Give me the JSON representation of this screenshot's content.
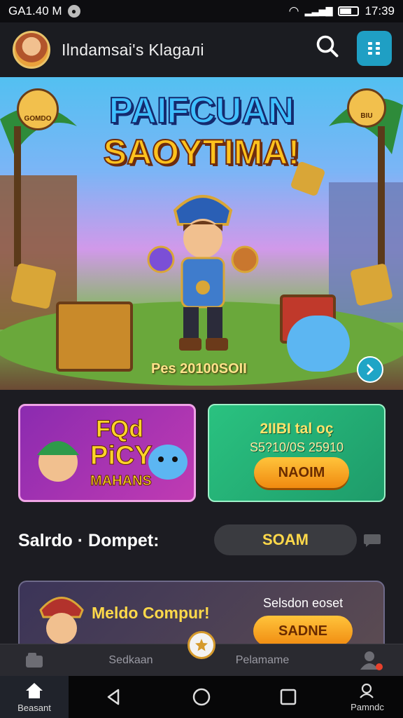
{
  "statusbar": {
    "carrier": "GA1.40 M",
    "time": "17:39"
  },
  "header": {
    "title": "Ilndamsai's Klagaлi",
    "search_icon": "search-icon",
    "menu_icon": "grid-menu-icon"
  },
  "banner": {
    "title_line1": "PAIFCUAN",
    "title_line2": "SAOYTIMA!",
    "badge_left": "GOMDO",
    "badge_right": "BIU",
    "caption": "Pes 20100SOII"
  },
  "promo_left": {
    "line1": "FQd",
    "line2": "PiCY",
    "line3": "MAHANS"
  },
  "promo_right": {
    "line1": "2IIBI tal oç",
    "line2": "S5?10/0S 25910",
    "button": "NAOIM"
  },
  "saldo": {
    "label": "Salrdo · Dompet:",
    "button": "SOAM"
  },
  "bottom_card": {
    "title": "Meldo Compur!",
    "subtitle": "Selsdon eoset",
    "button": "SADNE"
  },
  "app_nav": {
    "item_left": "Sedkaan",
    "item_right": "Pelamame"
  },
  "system_nav": {
    "home_label": "Beasant",
    "profile_label": "Pamndc"
  },
  "colors": {
    "accent": "#1f9fc4",
    "gold": "#ffd94a",
    "orange": "#f08a10",
    "green": "#2ac280",
    "purple": "#8b2bb0"
  }
}
